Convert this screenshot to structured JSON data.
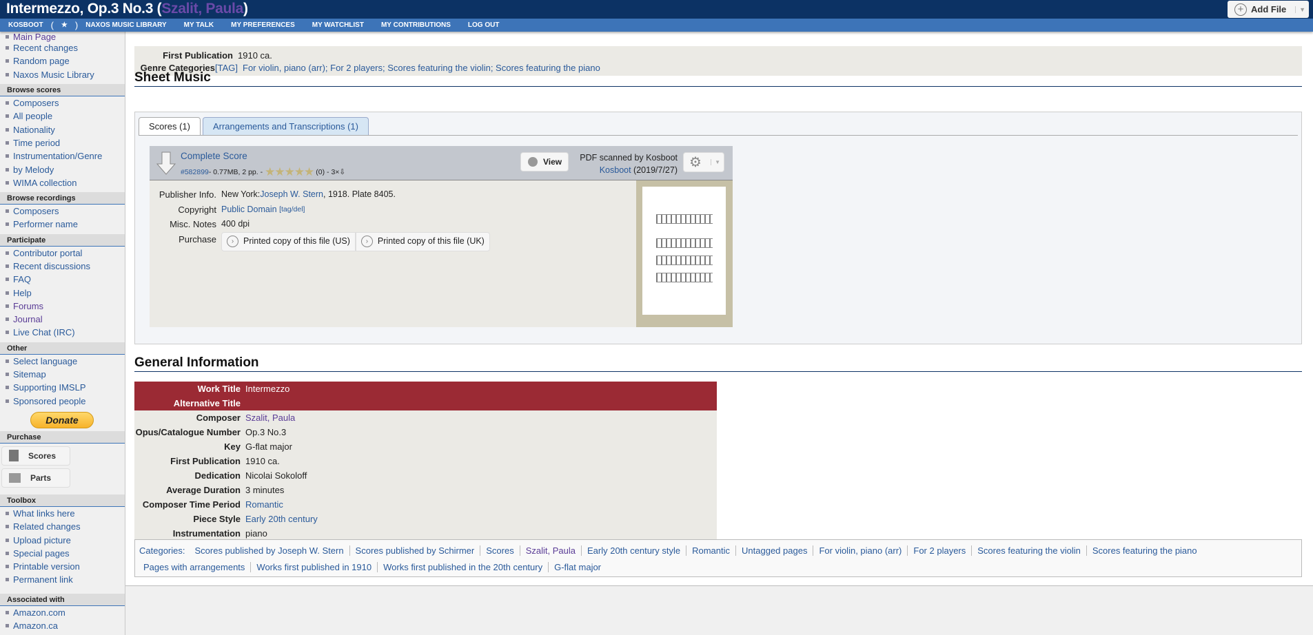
{
  "title": {
    "work": "Intermezzo, Op.3 No.3",
    "open": " (",
    "composer": "Szalit, Paula",
    "close": ")"
  },
  "add_file": "Add File",
  "nav": [
    "KOSBOOT",
    "(",
    "★",
    ")",
    "NAXOS MUSIC LIBRARY",
    "MY TALK",
    "MY PREFERENCES",
    "MY WATCHLIST",
    "MY CONTRIBUTIONS",
    "LOG OUT"
  ],
  "sidebar": {
    "top": [
      "Main Page",
      "Recent changes",
      "Random page",
      "Naxos Music Library"
    ],
    "browse_scores": {
      "title": "Browse scores",
      "items": [
        "Composers",
        "All people",
        "Nationality",
        "Time period",
        "Instrumentation/Genre",
        "by Melody",
        "WIMA collection"
      ]
    },
    "browse_recordings": {
      "title": "Browse recordings",
      "items": [
        "Composers",
        "Performer name"
      ]
    },
    "participate": {
      "title": "Participate",
      "items": [
        "Contributor portal",
        "Recent discussions",
        "FAQ",
        "Help",
        "Forums",
        "Journal",
        "Live Chat (IRC)"
      ]
    },
    "other": {
      "title": "Other",
      "items": [
        "Select language",
        "Sitemap",
        "Supporting IMSLP",
        "Sponsored people"
      ]
    },
    "donate": "Donate",
    "purchase": {
      "title": "Purchase",
      "scores": "Scores",
      "parts": "Parts"
    },
    "toolbox": {
      "title": "Toolbox",
      "items": [
        "What links here",
        "Related changes",
        "Upload picture",
        "Special pages",
        "Printable version",
        "Permanent link"
      ]
    },
    "associated": {
      "title": "Associated with",
      "items": [
        "Amazon.com",
        "Amazon.ca"
      ]
    }
  },
  "infobox": {
    "first_pub_label": "First Publication",
    "first_pub": "1910 ca.",
    "genre_label": "Genre Categories",
    "tag": "[TAG]",
    "genres": "For violin, piano (arr); For 2 players; Scores featuring the violin; Scores featuring the piano"
  },
  "sheet_music": {
    "heading": "Sheet Music",
    "tabs": [
      "Scores (1)",
      "Arrangements and Transcriptions (1)"
    ],
    "score": {
      "title": "Complete Score",
      "id": "#582899",
      "meta": " - 0.77MB, 2 pp. - ",
      "rating": "(0) - 3×⇩",
      "rating_stars": 0,
      "view": "View",
      "scanned": "PDF scanned by Kosboot",
      "uploader": "Kosboot",
      "date": " (2019/7/27)",
      "publisher_label": "Publisher Info.",
      "publisher_pre": "New York: ",
      "publisher": "Joseph W. Stern",
      "publisher_post": ", 1918. Plate 8405.",
      "copyright_label": "Copyright",
      "copyright": "Public Domain",
      "tagdel": "[tag/del]",
      "notes_label": "Misc. Notes",
      "notes": "400 dpi",
      "purchase_label": "Purchase",
      "buy_us": "Printed copy of this file (US)",
      "buy_uk": "Printed copy of this file (UK)"
    }
  },
  "general": {
    "heading": "General Information",
    "rows": [
      {
        "label": "Work Title",
        "value": "Intermezzo"
      },
      {
        "label": "Alternative Title",
        "value": ""
      },
      {
        "label": "Composer",
        "value": "Szalit, Paula"
      },
      {
        "label": "Opus/Catalogue Number",
        "value": "Op.3 No.3"
      },
      {
        "label": "Key",
        "value": "G-flat major"
      },
      {
        "label": "First Publication",
        "value": "1910 ca."
      },
      {
        "label": "Dedication",
        "value": "Nicolai Sokoloff"
      },
      {
        "label": "Average Duration",
        "value": "3 minutes"
      },
      {
        "label": "Composer Time Period",
        "value": "Romantic"
      },
      {
        "label": "Piece Style",
        "value": "Early 20th century"
      },
      {
        "label": "Instrumentation",
        "value": "piano"
      }
    ]
  },
  "categories": {
    "label": "Categories:",
    "items": [
      "Scores published by Joseph W. Stern",
      "Scores published by Schirmer",
      "Scores",
      "Szalit, Paula",
      "Early 20th century style",
      "Romantic",
      "Untagged pages",
      "For violin, piano (arr)",
      "For 2 players",
      "Scores featuring the violin",
      "Scores featuring the piano",
      "Pages with arrangements",
      "Works first published in 1910",
      "Works first published in the 20th century",
      "G-flat major"
    ]
  }
}
